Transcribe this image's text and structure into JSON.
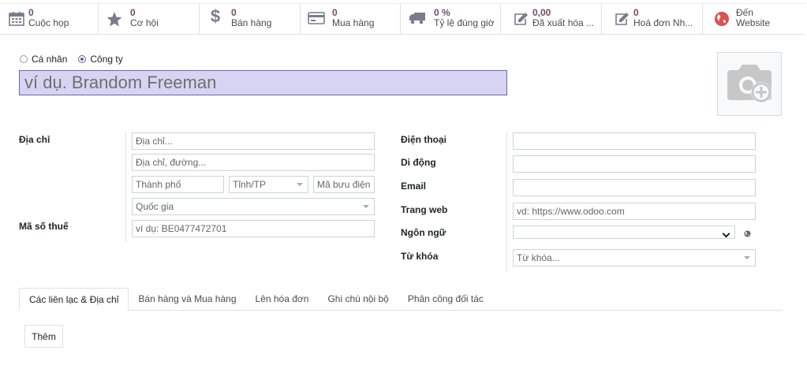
{
  "smart_buttons": [
    {
      "id": "meetings",
      "icon": "calendar-icon",
      "value": "0",
      "label": "Cuộc họp"
    },
    {
      "id": "opportunities",
      "icon": "star-icon",
      "value": "0",
      "label": "Cơ hội"
    },
    {
      "id": "sales",
      "icon": "dollar-icon",
      "value": "0",
      "label": "Bán hàng"
    },
    {
      "id": "purchases",
      "icon": "credit-card-icon",
      "value": "0",
      "label": "Mua hàng"
    },
    {
      "id": "on_time",
      "icon": "truck-icon",
      "value": "0 %",
      "label": "Tỷ lệ đúng giờ"
    },
    {
      "id": "invoiced",
      "icon": "edit-icon",
      "value": "0,00",
      "label": "Đã xuất hóa ..."
    },
    {
      "id": "vendor_bills",
      "icon": "edit-icon",
      "value": "0",
      "label": "Hoá đơn Nh..."
    },
    {
      "id": "website",
      "icon": "globe-icon",
      "value": "Đến",
      "label": "Website"
    }
  ],
  "company_type": {
    "individual_label": "Cá nhân",
    "company_label": "Công ty",
    "selected": "company"
  },
  "name_placeholder": "ví dụ. Brandom Freeman",
  "left": {
    "address_label": "Địa chỉ",
    "street_placeholder": "Địa chỉ...",
    "street2_placeholder": "Địa chỉ, đường...",
    "city_placeholder": "Thành phố",
    "state_placeholder": "Tỉnh/TP",
    "zip_placeholder": "Mã bưu điện",
    "country_placeholder": "Quốc gia",
    "vat_label": "Mã số thuế",
    "vat_placeholder": "ví dụ: BE0477472701"
  },
  "right": {
    "phone_label": "Điện thoại",
    "mobile_label": "Di động",
    "email_label": "Email",
    "website_label": "Trang web",
    "website_placeholder": "vd: https://www.odoo.com",
    "lang_label": "Ngôn ngữ",
    "tags_label": "Từ khóa",
    "tags_placeholder": "Từ khóa..."
  },
  "tabs": [
    {
      "label": "Các liên lạc & Địa chỉ",
      "active": true
    },
    {
      "label": "Bán hàng và Mua hàng",
      "active": false
    },
    {
      "label": "Lên hóa đơn",
      "active": false
    },
    {
      "label": "Ghi chú nội bộ",
      "active": false
    },
    {
      "label": "Phân công đối tác",
      "active": false
    }
  ],
  "add_button_label": "Thêm",
  "colors": {
    "accent": "#714b67",
    "name_bg": "#d7d4f3",
    "globe": "#d9534f"
  }
}
